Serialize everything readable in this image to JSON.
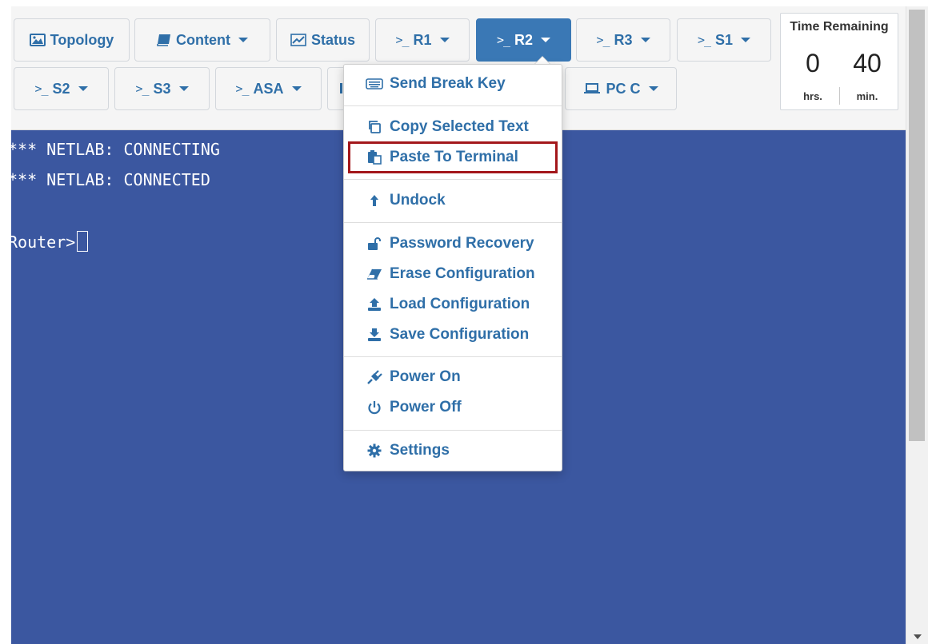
{
  "toolbar": {
    "buttons": [
      {
        "label": "Topology",
        "icon": "image-icon"
      },
      {
        "label": "Content",
        "icon": "book-icon"
      },
      {
        "label": "Status",
        "icon": "chart-icon"
      },
      {
        "label": "R1",
        "icon": "terminal-icon"
      },
      {
        "label": "R2",
        "icon": "terminal-icon",
        "active": true
      },
      {
        "label": "R3",
        "icon": "terminal-icon"
      },
      {
        "label": "S1",
        "icon": "terminal-icon"
      },
      {
        "label": "S2",
        "icon": "terminal-icon"
      },
      {
        "label": "S3",
        "icon": "terminal-icon"
      },
      {
        "label": "ASA",
        "icon": "terminal-icon"
      },
      {
        "label": "PC C",
        "icon": "laptop-icon"
      }
    ],
    "prompt_glyph": ">_"
  },
  "time_remaining": {
    "title": "Time Remaining",
    "hours": "0",
    "minutes": "40",
    "hours_label": "hrs.",
    "minutes_label": "min."
  },
  "terminal": {
    "lines": [
      "*** NETLAB: CONNECTING",
      "*** NETLAB: CONNECTED",
      "",
      "Router>"
    ]
  },
  "menu": {
    "items": [
      {
        "label": "Send Break Key",
        "icon": "keyboard-icon"
      },
      {
        "label": "Copy Selected Text",
        "icon": "copy-icon"
      },
      {
        "label": "Paste To Terminal",
        "icon": "paste-icon",
        "highlighted": true
      },
      {
        "label": "Undock",
        "icon": "undock-icon"
      },
      {
        "label": "Password Recovery",
        "icon": "unlock-icon"
      },
      {
        "label": "Erase Configuration",
        "icon": "eraser-icon"
      },
      {
        "label": "Load Configuration",
        "icon": "upload-icon"
      },
      {
        "label": "Save Configuration",
        "icon": "download-icon"
      },
      {
        "label": "Power On",
        "icon": "plug-icon"
      },
      {
        "label": "Power Off",
        "icon": "power-icon"
      },
      {
        "label": "Settings",
        "icon": "gear-icon"
      }
    ]
  },
  "colors": {
    "terminal_bg": "#3b57a0",
    "accent": "#3a78b5",
    "link": "#2f6fa8",
    "highlight_border": "#a3171b"
  }
}
